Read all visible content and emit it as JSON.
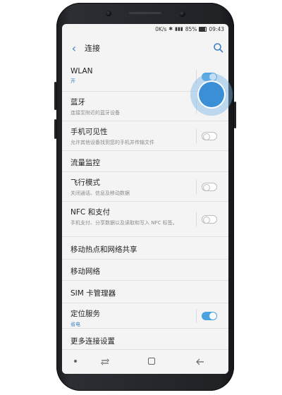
{
  "status_bar": {
    "net_speed": "0K/s",
    "battery": "85%",
    "time": "09:43"
  },
  "header": {
    "title": "连接"
  },
  "colors": {
    "accent": "#4aa3e0",
    "link_blue": "#3d7fc4"
  },
  "rows": [
    {
      "label": "WLAN",
      "sub": "开",
      "toggle": "on"
    },
    {
      "label": "蓝牙",
      "sub": "连接至附近的蓝牙设备",
      "toggle": "tapped"
    },
    {
      "label": "手机可见性",
      "sub": "允许其他设备找到您的手机并传输文件",
      "toggle": "off"
    },
    {
      "label": "流量监控"
    },
    {
      "label": "飞行模式",
      "sub": "关闭通话、信息及移动数据",
      "toggle": "off"
    },
    {
      "label": "NFC 和支付",
      "sub": "手机支付、分享数据以及读取和写入 NFC 标签。",
      "toggle": "off"
    },
    {
      "label": "移动热点和网络共享"
    },
    {
      "label": "移动网络"
    },
    {
      "label": "SIM 卡管理器"
    },
    {
      "label": "定位服务",
      "sub": "省电",
      "toggle": "on"
    },
    {
      "label": "更多连接设置"
    }
  ]
}
